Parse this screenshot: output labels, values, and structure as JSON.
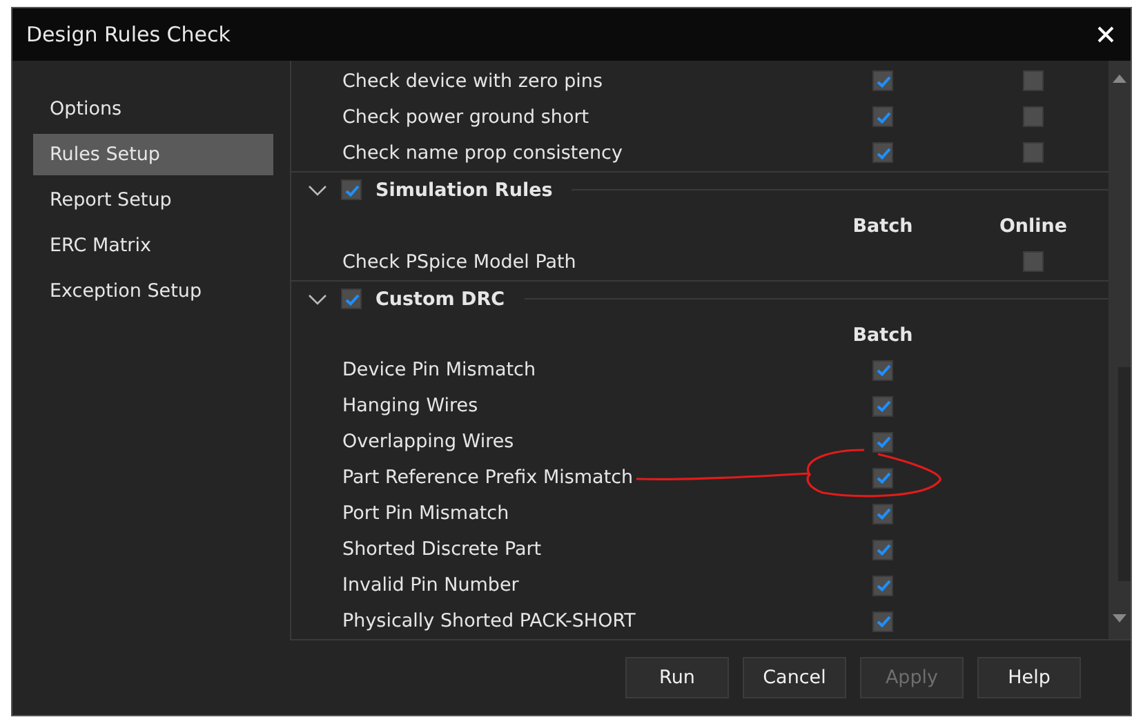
{
  "window": {
    "title": "Design Rules Check"
  },
  "sidebar": {
    "items": [
      {
        "label": "Options",
        "selected": false
      },
      {
        "label": "Rules Setup",
        "selected": true
      },
      {
        "label": "Report Setup",
        "selected": false
      },
      {
        "label": "ERC Matrix",
        "selected": false
      },
      {
        "label": "Exception Setup",
        "selected": false
      }
    ]
  },
  "rules_top": [
    {
      "label": "Check device with zero pins",
      "batch": true,
      "online": false
    },
    {
      "label": "Check power ground short",
      "batch": true,
      "online": false
    },
    {
      "label": "Check name prop consistency",
      "batch": true,
      "online": false
    }
  ],
  "sections": [
    {
      "title": "Simulation Rules",
      "checked": true,
      "expanded": true,
      "columns": [
        "Batch",
        "Online"
      ],
      "rules": [
        {
          "label": "Check PSpice Model Path",
          "online": false
        }
      ]
    },
    {
      "title": "Custom DRC",
      "checked": true,
      "expanded": true,
      "columns": [
        "Batch"
      ],
      "rules": [
        {
          "label": "Device Pin Mismatch",
          "batch": true
        },
        {
          "label": "Hanging Wires",
          "batch": true
        },
        {
          "label": "Overlapping Wires",
          "batch": true
        },
        {
          "label": "Part Reference Prefix Mismatch",
          "batch": true,
          "circled": true
        },
        {
          "label": "Port Pin Mismatch",
          "batch": true
        },
        {
          "label": "Shorted Discrete Part",
          "batch": true
        },
        {
          "label": "Invalid Pin Number",
          "batch": true
        },
        {
          "label": "Physically Shorted PACK-SHORT",
          "batch": true
        }
      ]
    }
  ],
  "buttons": [
    {
      "label": "Run",
      "disabled": false
    },
    {
      "label": "Cancel",
      "disabled": false
    },
    {
      "label": "Apply",
      "disabled": true
    },
    {
      "label": "Help",
      "disabled": false
    }
  ]
}
